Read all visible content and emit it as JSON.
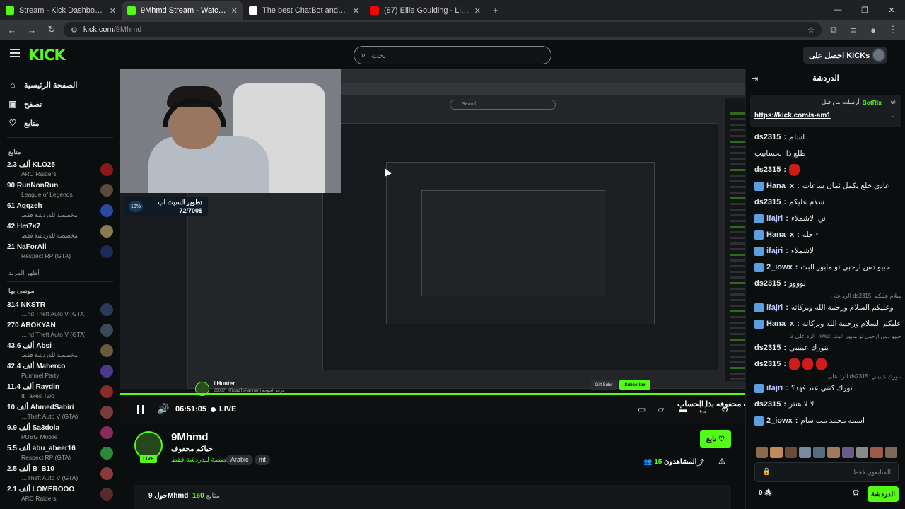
{
  "browser": {
    "tabs": [
      {
        "title": "Stream - Kick Dashboard",
        "color": "#53fc18",
        "active": false
      },
      {
        "title": "9Mhmd Stream - Watch Live",
        "color": "#53fc18",
        "active": true
      },
      {
        "title": "The best ChatBot and Widgets",
        "color": "#ffffff",
        "active": false
      },
      {
        "title": "(87) Ellie Goulding - Lights (Lyri",
        "color": "#ff0000",
        "active": false
      }
    ],
    "url_host": "kick.com",
    "url_path": "/9Mhmd"
  },
  "header": {
    "logo": "KICK",
    "search_placeholder": "بحث",
    "get_kicks": "احصل على KICKs"
  },
  "sidebar": {
    "nav": [
      {
        "label": "الصفحة الرئيسية",
        "icon": "home-icon",
        "glyph": "⌂"
      },
      {
        "label": "تصفح",
        "icon": "browse-icon",
        "glyph": "▣"
      },
      {
        "label": "متابع",
        "icon": "heart-icon",
        "glyph": "♡"
      }
    ],
    "following_title": "متابع",
    "following": [
      {
        "name": "KLO25",
        "count": "2.3 ألف",
        "category": "ARC Raiders",
        "color": "#8a1a1a"
      },
      {
        "name": "RunNonRun",
        "count": "90",
        "category": "League of Legends",
        "color": "#5a4a3a"
      },
      {
        "name": "Aqqzeh",
        "count": "61",
        "category": "مخصصة للدردشة فقط",
        "color": "#2a4aa0"
      },
      {
        "name": "Hm7×7",
        "count": "42",
        "category": "مخصصة للدردشة فقط",
        "color": "#8a7a50"
      },
      {
        "name": "NaForAll",
        "count": "21",
        "category": "Respect RP (GTA)",
        "color": "#1a2a5a"
      }
    ],
    "show_more": "أظهر المزيد",
    "recommended_title": "موصى بها",
    "recommended": [
      {
        "name": "NKSTR",
        "count": "314",
        "category": "…nd Theft Auto V (GTA)",
        "color": "#2a3a5a"
      },
      {
        "name": "ABOKYAN",
        "count": "270",
        "category": "…nd Theft Auto V (GTA)",
        "color": "#3a4a5a"
      },
      {
        "name": "Absi",
        "count": "43.6 ألف",
        "category": "مخصصة للدردشة فقط",
        "color": "#6a5a3a"
      },
      {
        "name": "Maherco",
        "count": "42.4 ألف",
        "category": "Pummel Party",
        "color": "#4a3a8a"
      },
      {
        "name": "Raydin",
        "count": "11.4 ألف",
        "category": "It Takes Two",
        "color": "#8a2a2a"
      },
      {
        "name": "AhmedSabiri",
        "count": "10 ألف",
        "category": "…Theft Auto V (GTA)",
        "color": "#7a3a3a"
      },
      {
        "name": "Sa3dola",
        "count": "9.9 ألف",
        "category": "PUBG Mobile",
        "color": "#8a2a5a"
      },
      {
        "name": "abu_abeer16",
        "count": "5.5 ألف",
        "category": "Respect RP (GTA)",
        "color": "#2a8a3a"
      },
      {
        "name": "B_B10",
        "count": "2.5 ألف",
        "category": "…Theft Auto V (GTA)",
        "color": "#8a3a3a"
      },
      {
        "name": "LOMEROOO",
        "count": "2.1 ألف",
        "category": "ARC Raiders",
        "color": "#5a2a2a"
      }
    ]
  },
  "video": {
    "goal_title": "تطوير السيت اب",
    "goal_amount": "72/700$",
    "goal_percent": "10%",
    "inner_search": "Search",
    "inner_streamer": "iiHunter",
    "inner_sub": "20007] #RoadToPartner | فزعة الحوجة",
    "inner_gift": "Gift Subs",
    "inner_subscribe": "Subscribe",
    "time": "06:51:05",
    "live": "LIVE",
    "progress": 1.0,
    "toast": "هو بيث محفوفه بذا الحساب : OHLA"
  },
  "stream": {
    "name": "9Mhmd",
    "title": "حياكم محفوف",
    "category": "مخصصة للدردشة فقط",
    "tags": [
      "Arabic",
      "mt"
    ],
    "live_badge": "LIVE",
    "follow": "تابع",
    "viewers_label": "المشاهدون",
    "viewers": "15",
    "about_prefix": "حول",
    "about_name": "9Mhmd",
    "followers_count": "160",
    "followers_label": "متابع"
  },
  "chat": {
    "title": "الدردشة",
    "pinned_from": "أرسلت من قبل",
    "pinned_user": "BotRix",
    "pinned_link": "https://kick.com/s-am1",
    "messages": [
      {
        "user": "ds2315",
        "color": "#e8e8e8",
        "text": "اسلم",
        "badge": false,
        "emotes": 0
      },
      {
        "user": "",
        "color": "#e8e8e8",
        "text": "طلع ذا الحسابيب",
        "badge": false,
        "emotes": 0
      },
      {
        "user": "ds2315",
        "color": "#e8e8e8",
        "text": "",
        "badge": false,
        "emotes": 1
      },
      {
        "user": "Hana_x",
        "color": "#cfe3f5",
        "text": "عادي خلع يكمل ثمان ساعات",
        "badge": true,
        "emotes": 0
      },
      {
        "user": "ds2315",
        "color": "#e8e8e8",
        "text": "سلام عليكم",
        "badge": false,
        "emotes": 0
      },
      {
        "user": "ifajri",
        "color": "#b9c8ff",
        "text": "نن الاشملاء",
        "badge": true,
        "emotes": 0
      },
      {
        "user": "Hana_x",
        "color": "#cfe3f5",
        "text": "خله *",
        "badge": true,
        "emotes": 0
      },
      {
        "user": "ifajri",
        "color": "#b9c8ff",
        "text": "الاشملاء",
        "badge": true,
        "emotes": 0
      },
      {
        "user": "2_iowx",
        "color": "#cfe3f5",
        "text": "حبيو دس ارحبي تو مابور البث",
        "badge": true,
        "emotes": 0
      },
      {
        "user": "ds2315",
        "color": "#e8e8e8",
        "text": "لوووو",
        "badge": false,
        "emotes": 0
      },
      {
        "user": "ifajri",
        "color": "#b9c8ff",
        "text": "وعليكم السلام ورحمة الله وبركاته",
        "badge": true,
        "emotes": 0,
        "reply": "الرد على ds2315: سلام عليكم"
      },
      {
        "user": "Hana_x",
        "color": "#cfe3f5",
        "text": "وعليكم السلام ورحمة الله وبركاته",
        "badge": true,
        "emotes": 0
      },
      {
        "user": "ds2315",
        "color": "#e8e8e8",
        "text": "بنورك عيبيبي",
        "badge": false,
        "emotes": 0,
        "reply": "الرد على 2_iowx: حبيو دس ارحبي تو مابور البث"
      },
      {
        "user": "ds2315",
        "color": "#e8e8e8",
        "text": "",
        "badge": false,
        "emotes": 3
      },
      {
        "user": "ifajri",
        "color": "#b9c8ff",
        "text": "نورك كتني عند فهد؟",
        "badge": true,
        "emotes": 0,
        "reply": "الرد على ds2315: بنورك عيبيبي"
      },
      {
        "user": "ds2315",
        "color": "#e8e8e8",
        "text": "لا لا هنتر",
        "badge": false,
        "emotes": 0
      },
      {
        "user": "2_iowx",
        "color": "#cfe3f5",
        "text": "اسمه محمد مب سام",
        "badge": true,
        "emotes": 0
      }
    ],
    "input_placeholder": "المتابعون فقط",
    "points": "0",
    "send": "الدردشة"
  }
}
